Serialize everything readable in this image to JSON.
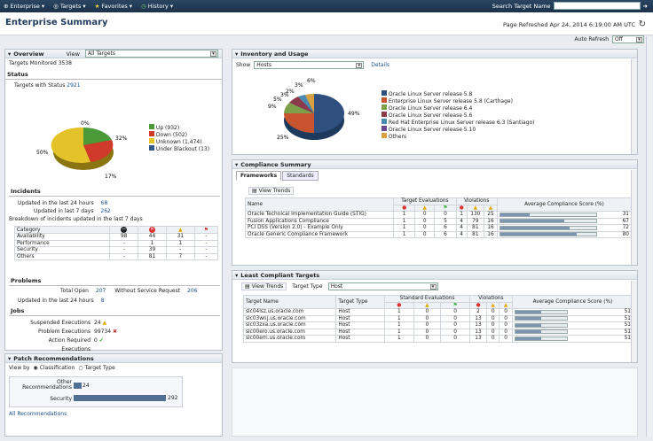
{
  "topbar": {
    "enterprise": "Enterprise",
    "targets": "Targets",
    "favorites": "Favorites",
    "history": "History",
    "search_label": "Search Target Name",
    "search_placeholder": ""
  },
  "header": {
    "title": "Enterprise Summary",
    "refreshed": "Page Refreshed Apr 24, 2014 6:19:00 AM UTC",
    "auto_refresh_label": "Auto Refresh",
    "auto_refresh_value": "Off"
  },
  "overview": {
    "title": "Overview",
    "view_label": "View",
    "view_value": "All Targets",
    "monitored_label": "Targets Monitored",
    "monitored_value": "3538",
    "status_title": "Status",
    "with_status_label": "Targets with Status",
    "with_status_value": "2921",
    "pie_labels": [
      "0%",
      "32%",
      "50%",
      "17%"
    ],
    "legend": [
      {
        "label": "Up (932)",
        "color": "#4a9a3a"
      },
      {
        "label": "Down (502)",
        "color": "#d03a2a"
      },
      {
        "label": "Unknown (1,474)",
        "color": "#e3c22a"
      },
      {
        "label": "Under Blackout (13)",
        "color": "#355a8a"
      }
    ]
  },
  "incidents": {
    "title": "Incidents",
    "r1_label": "Updated in the last 24 hours",
    "r1_value": "68",
    "r2_label": "Updated in last 7 days",
    "r2_value": "262",
    "breakdown": "Breakdown of incidents updated in the last 7 days",
    "col_category": "Category",
    "rows": [
      [
        "Availability",
        "98",
        "44",
        "31",
        "-"
      ],
      [
        "Performance",
        "-",
        "1",
        "1",
        "-"
      ],
      [
        "Security",
        "-",
        "39",
        "-",
        "-"
      ],
      [
        "Others",
        "-",
        "81",
        "7",
        "-"
      ]
    ]
  },
  "problems": {
    "title": "Problems",
    "total_label": "Total Open",
    "total_value": "207",
    "wsr_label": "Without Service Request",
    "wsr_value": "206",
    "upd_label": "Updated in the last 24 hours",
    "upd_value": "8"
  },
  "jobs": {
    "title": "Jobs",
    "rows": [
      {
        "label": "Suspended Executions",
        "value": "24"
      },
      {
        "label": "Problem Executions",
        "value": "99734"
      },
      {
        "label": "Action Required Executions",
        "value": "0"
      }
    ]
  },
  "patch": {
    "title": "Patch Recommendations",
    "view_by": "View by",
    "opt1": "Classification",
    "opt2": "Target Type",
    "bars": [
      {
        "label": "Other Recommendations",
        "value": 24
      },
      {
        "label": "Security",
        "value": 292
      }
    ],
    "v1": "24",
    "v2": "292",
    "all_link": "All Recommendations"
  },
  "inventory": {
    "title": "Inventory and Usage",
    "show_label": "Show",
    "show_value": "Hosts",
    "details": "Details",
    "pie_labels": [
      "6%",
      "3%",
      "2%",
      "9%",
      "5%",
      "3%",
      "25%",
      "49%"
    ],
    "legend": [
      {
        "label": "Oracle Linux Server release 5.8",
        "color": "#2f4f7f"
      },
      {
        "label": "Enterprise Linux Server release 5.8 (Carthage)",
        "color": "#c8532f"
      },
      {
        "label": "Oracle Linux Server release 6.4",
        "color": "#7fa04a"
      },
      {
        "label": "Oracle Linux Server release 5.6",
        "color": "#8a3a4a"
      },
      {
        "label": "Red Hat Enterprise Linux Server release 6.3 (Santiago)",
        "color": "#4a8ab0"
      },
      {
        "label": "Oracle Linux Server release 5.10",
        "color": "#6a4a8a"
      },
      {
        "label": "Others",
        "color": "#d8a040"
      }
    ]
  },
  "compliance": {
    "title": "Compliance Summary",
    "tab1": "Frameworks",
    "tab2": "Standards",
    "trends": "View Trends",
    "col_name": "Name",
    "col_eval": "Target Evaluations",
    "col_viol": "Violations",
    "col_score": "Average Compliance Score (%)",
    "rows": [
      {
        "name": "Oracle Technical Implementation Guide (STIG)",
        "v": [
          "1",
          "0",
          "0",
          "1",
          "130",
          "25"
        ],
        "score": 31
      },
      {
        "name": "Fusion Applications Compliance",
        "v": [
          "1",
          "0",
          "5",
          "4",
          "79",
          "16"
        ],
        "score": 67
      },
      {
        "name": "PCI DSS (Version 2.0) - Example Only",
        "v": [
          "1",
          "0",
          "6",
          "4",
          "81",
          "16"
        ],
        "score": 72
      },
      {
        "name": "Oracle Generic Compliance Framework",
        "v": [
          "1",
          "0",
          "6",
          "4",
          "81",
          "16"
        ],
        "score": 80
      }
    ]
  },
  "least": {
    "title": "Least Compliant Targets",
    "trends": "View Trends",
    "type_label": "Target Type",
    "type_value": "Host",
    "col_target": "Target Name",
    "col_type": "Target Type",
    "col_eval": "Standard Evaluations",
    "col_viol": "Violations",
    "col_score": "Average Compliance Score (%)",
    "rows": [
      {
        "name": "slc04lsz.us.oracle.com",
        "type": "Host",
        "v": [
          "1",
          "0",
          "0",
          "2",
          "0",
          "0"
        ],
        "score": 51
      },
      {
        "name": "slc03wnj.us.oracle.com",
        "type": "Host",
        "v": [
          "1",
          "0",
          "0",
          "13",
          "0",
          "0"
        ],
        "score": 51
      },
      {
        "name": "slc03zxa.us.oracle.com",
        "type": "Host",
        "v": [
          "1",
          "0",
          "0",
          "13",
          "0",
          "0"
        ],
        "score": 51
      },
      {
        "name": "slc00ero.us.oracle.com",
        "type": "Host",
        "v": [
          "1",
          "0",
          "0",
          "13",
          "0",
          "0"
        ],
        "score": 51
      },
      {
        "name": "slc00ern.us.oracle.com",
        "type": "Host",
        "v": [
          "1",
          "0",
          "0",
          "13",
          "0",
          "0"
        ],
        "score": 51
      }
    ]
  }
}
